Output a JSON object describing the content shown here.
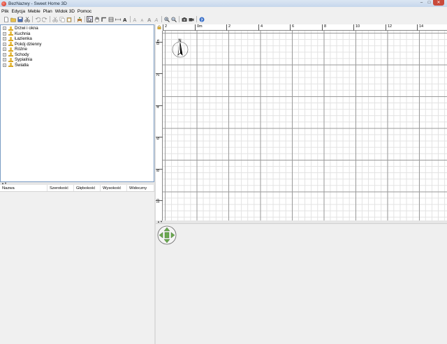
{
  "window": {
    "title": "BezNazwy - Sweet Home 3D",
    "controls": {
      "minimize": "–",
      "maximize": "□",
      "close": "✕"
    }
  },
  "menu": [
    "Plik",
    "Edycja",
    "Meble",
    "Plan",
    "Widok 3D",
    "Pomoc"
  ],
  "toolbar": [
    "new-icon",
    "open-icon",
    "save-icon",
    "cut-icon",
    "separator",
    "undo-icon",
    "redo-icon",
    "separator",
    "cut-icon",
    "copy-icon",
    "paste-icon",
    "separator",
    "add-furniture-icon",
    "separator",
    "select-icon",
    "pan-icon",
    "create-walls-icon",
    "create-rooms-icon",
    "create-dimensions-icon",
    "create-labels-icon",
    "separator",
    "increase-text-icon",
    "decrease-text-icon",
    "bold-icon",
    "italic-icon",
    "separator",
    "zoom-in-icon",
    "zoom-out-icon",
    "separator",
    "create-photo-icon",
    "create-video-icon",
    "separator",
    "help-icon"
  ],
  "catalog": {
    "categories": [
      {
        "label": "Drzwi i okna"
      },
      {
        "label": "Kuchnia"
      },
      {
        "label": "Łazienka"
      },
      {
        "label": "Pokój dzienny"
      },
      {
        "label": "Różne"
      },
      {
        "label": "Schody"
      },
      {
        "label": "Sypialnia"
      },
      {
        "label": "Światła"
      }
    ]
  },
  "furniture_table": {
    "columns": [
      "Nazwa",
      "Szerokość",
      "Głębokość",
      "Wysokość",
      "Widoczny"
    ]
  },
  "plan": {
    "ruler_x": [
      "0m",
      "2",
      "4",
      "6",
      "8",
      "10",
      "12",
      "14"
    ],
    "ruler_y": [
      "0m",
      "2",
      "4",
      "6",
      "8",
      "10"
    ],
    "compass_label": "N"
  },
  "colors": {
    "grid_major": "#9a9a9a",
    "grid_minor": "#e2e2e2",
    "nav_widget": "#6aa84f",
    "folder": "#e8c04a"
  }
}
